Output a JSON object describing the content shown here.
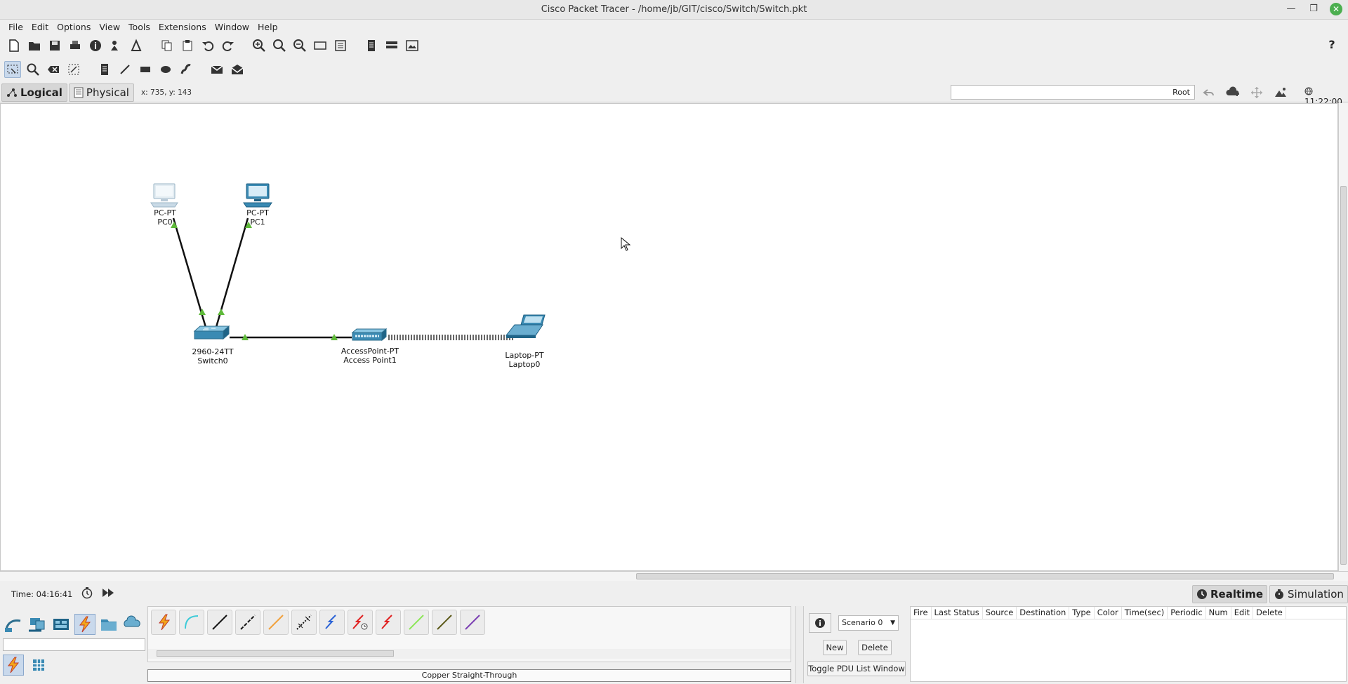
{
  "window": {
    "title": "Cisco Packet Tracer - /home/jb/GIT/cisco/Switch/Switch.pkt"
  },
  "menu": [
    "File",
    "Edit",
    "Options",
    "View",
    "Tools",
    "Extensions",
    "Window",
    "Help"
  ],
  "viewbar": {
    "logical_label": "Logical",
    "physical_label": "Physical",
    "coordinates": "x: 735, y: 143",
    "root_label": "Root",
    "clock": "11:22:00"
  },
  "devices": [
    {
      "model": "PC-PT",
      "name": "PC0"
    },
    {
      "model": "PC-PT",
      "name": "PC1"
    },
    {
      "model": "2960-24TT",
      "name": "Switch0"
    },
    {
      "model": "AccessPoint-PT",
      "name": "Access Point1"
    },
    {
      "model": "Laptop-PT",
      "name": "Laptop0"
    }
  ],
  "status": {
    "time_label": "Time: 04:16:41",
    "realtime_label": "Realtime",
    "simulation_label": "Simulation"
  },
  "cable_panel": {
    "selected_cable": "Copper Straight-Through"
  },
  "scenario": {
    "selected": "Scenario 0",
    "new_label": "New",
    "delete_label": "Delete",
    "toggle_label": "Toggle PDU List Window"
  },
  "pdu_table": {
    "columns": [
      "Fire",
      "Last Status",
      "Source",
      "Destination",
      "Type",
      "Color",
      "Time(sec)",
      "Periodic",
      "Num",
      "Edit",
      "Delete"
    ]
  }
}
